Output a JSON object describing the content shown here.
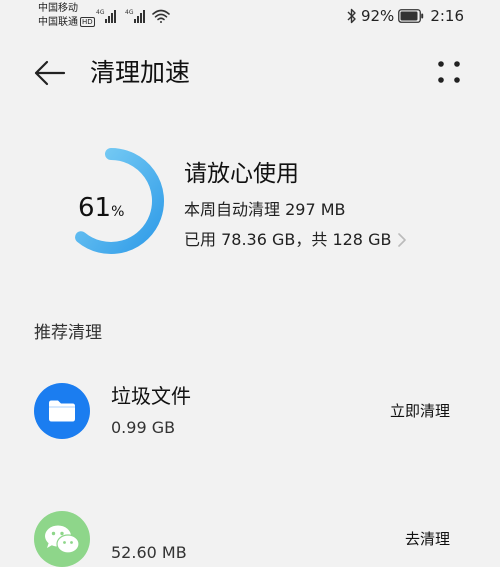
{
  "status_bar": {
    "carrier_1": "中国移动",
    "carrier_2": "中国联通",
    "hd_badge": "HD",
    "network_1": "4G",
    "network_2": "4G",
    "battery": "92%",
    "time": "2:16",
    "icons": [
      "signal-icon",
      "signal-icon",
      "wifi-icon",
      "bluetooth-icon",
      "battery-icon"
    ]
  },
  "header": {
    "title": "清理加速",
    "back_icon": "back-arrow-icon",
    "more_icon": "more-dots-icon"
  },
  "storage": {
    "percent_value": "61",
    "percent_unit": "%",
    "status_title": "请放心使用",
    "weekly_cleanup": "本周自动清理 297 MB",
    "usage": "已用 78.36 GB，共 128 GB",
    "used_fraction": 0.61,
    "gauge_color_start": "#7ed0f5",
    "gauge_color_end": "#2f9be8"
  },
  "recommended": {
    "section_title": "推荐清理",
    "items": [
      {
        "title": "垃圾文件",
        "size": "0.99 GB",
        "action": "立即清理",
        "icon": "folder-icon",
        "icon_bg": "#1b7df0"
      },
      {
        "title": "",
        "size": "52.60 MB",
        "action": "去清理",
        "icon": "wechat-icon",
        "icon_bg": "#8ed68a"
      }
    ]
  }
}
